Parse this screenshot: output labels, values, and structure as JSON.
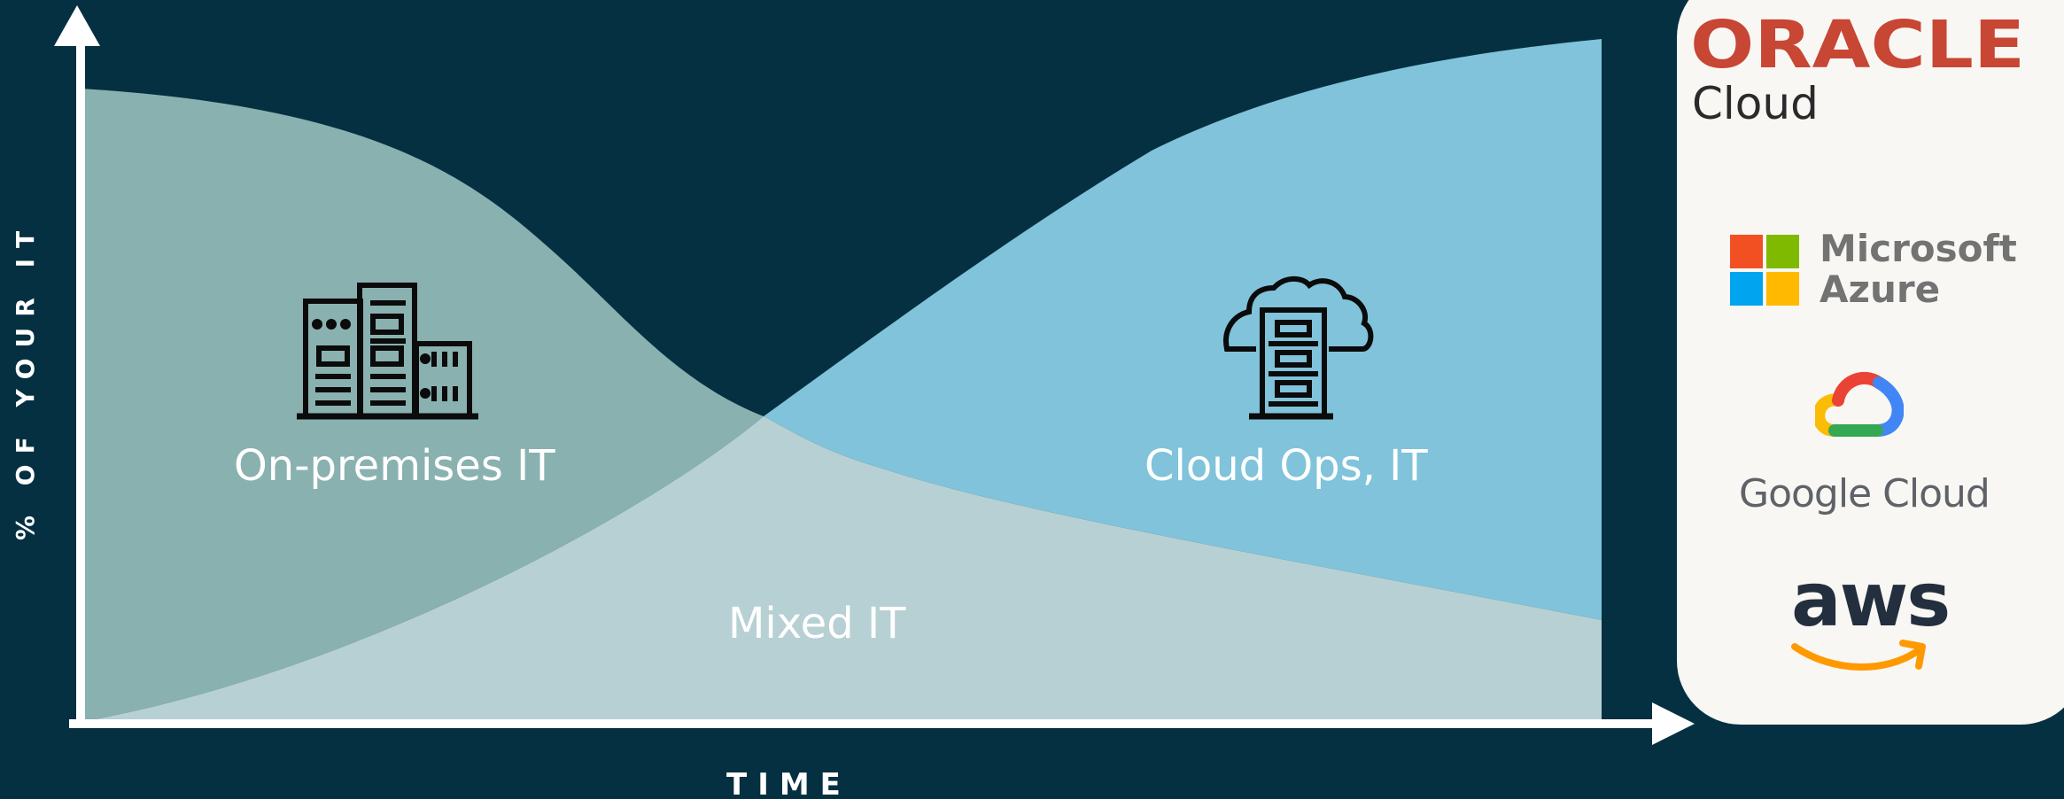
{
  "diagram": {
    "y_axis_title": "% OF YOUR IT",
    "x_axis_title": "TIME",
    "regions": {
      "on_premises": "On-premises IT",
      "cloud_ops": "Cloud Ops, IT",
      "mixed": "Mixed IT"
    },
    "colors": {
      "background": "#053041",
      "on_premises": "#89b1b0",
      "cloud_ops": "#80c3db",
      "mixed": "#b7d0d3",
      "axis": "#ffffff"
    },
    "icons": [
      "server-building-icon",
      "cloud-server-icon"
    ]
  },
  "providers": {
    "oracle": {
      "name": "ORACLE",
      "sub": "Cloud",
      "color": "#c74634"
    },
    "microsoft": {
      "line1": "Microsoft",
      "line2": "Azure"
    },
    "google": {
      "name": "Google Cloud"
    },
    "aws": {
      "name": "aws",
      "smile_color": "#ff9900"
    }
  }
}
